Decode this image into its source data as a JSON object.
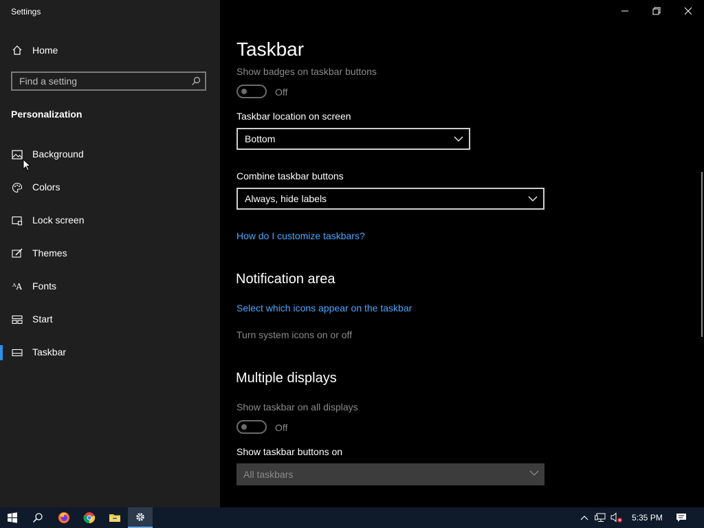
{
  "window": {
    "title": "Settings"
  },
  "sidebar": {
    "home_label": "Home",
    "search_placeholder": "Find a setting",
    "section_title": "Personalization",
    "items": [
      {
        "label": "Background",
        "icon": "image-icon"
      },
      {
        "label": "Colors",
        "icon": "palette-icon"
      },
      {
        "label": "Lock screen",
        "icon": "lock-screen-icon"
      },
      {
        "label": "Themes",
        "icon": "brush-icon"
      },
      {
        "label": "Fonts",
        "icon": "font-icon"
      },
      {
        "label": "Start",
        "icon": "start-icon"
      },
      {
        "label": "Taskbar",
        "icon": "taskbar-icon",
        "active": true
      }
    ]
  },
  "main": {
    "page_title": "Taskbar",
    "badges": {
      "label": "Show badges on taskbar buttons",
      "state": "Off"
    },
    "location": {
      "label": "Taskbar location on screen",
      "value": "Bottom"
    },
    "combine": {
      "label": "Combine taskbar buttons",
      "value": "Always, hide labels"
    },
    "help_link": "How do I customize taskbars?",
    "notification_area": {
      "heading": "Notification area",
      "link1": "Select which icons appear on the taskbar",
      "link2": "Turn system icons on or off"
    },
    "multiple_displays": {
      "heading": "Multiple displays",
      "show_all_label": "Show taskbar on all displays",
      "show_all_state": "Off",
      "buttons_on_label": "Show taskbar buttons on",
      "buttons_on_value": "All taskbars"
    }
  },
  "taskbar": {
    "time": "5:35 PM",
    "accent": "#2f8fe8"
  }
}
